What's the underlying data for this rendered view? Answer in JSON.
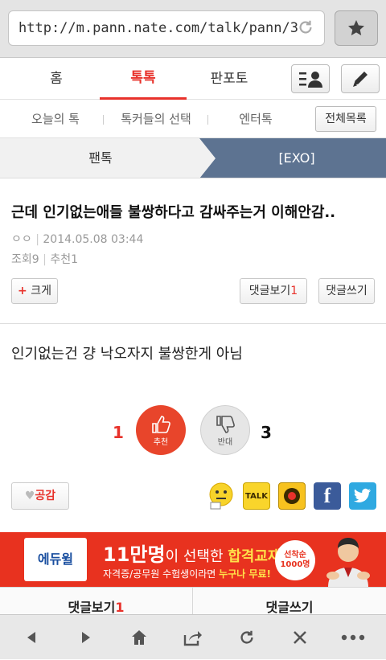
{
  "browser": {
    "url": "http://m.pann.nate.com/talk/pann/3"
  },
  "nav": {
    "tabs": [
      {
        "label": "홈"
      },
      {
        "label": "톡톡"
      },
      {
        "label": "판포토"
      }
    ],
    "active_color": "#e8322b"
  },
  "subnav": {
    "items": [
      "오늘의 톡",
      "톡커들의 선택",
      "엔터톡"
    ],
    "full_list": "전체목록"
  },
  "breadcrumb": {
    "left": "팬톡",
    "right": "[EXO]"
  },
  "post": {
    "title": "근데 인기없는애들 불쌍하다고 감싸주는거 이해안감..",
    "author": "ㅇㅇ",
    "date": "2014.05.08 03:44",
    "views_label": "조회",
    "views": "9",
    "recommend_label": "추천",
    "recommend": "1",
    "bigger_plus": "+",
    "bigger": "크게",
    "comment_view": "댓글보기",
    "comment_count": "1",
    "comment_write": "댓글쓰기",
    "body": "인기없는건 걍 낙오자지 불쌍한게 아님"
  },
  "votes": {
    "up_count": "1",
    "up_label": "추천",
    "down_count": "3",
    "down_label": "반대"
  },
  "share": {
    "like_label": "공감",
    "kakaotalk_text": "TALK",
    "facebook_text": "f"
  },
  "ad": {
    "brand": "에듀윌",
    "line1_big": "11만명",
    "line1_mid": "이 선택한 ",
    "line1_highlight": "합격교재!",
    "line2_prefix": "자격증/공무원 수험생이라면 ",
    "line2_highlight": "누구나 무료!",
    "badge_top": "선착순",
    "badge_bottom": "1000명"
  },
  "comment_bar": {
    "view": "댓글보기",
    "count": "1",
    "write": "댓글쓰기"
  }
}
